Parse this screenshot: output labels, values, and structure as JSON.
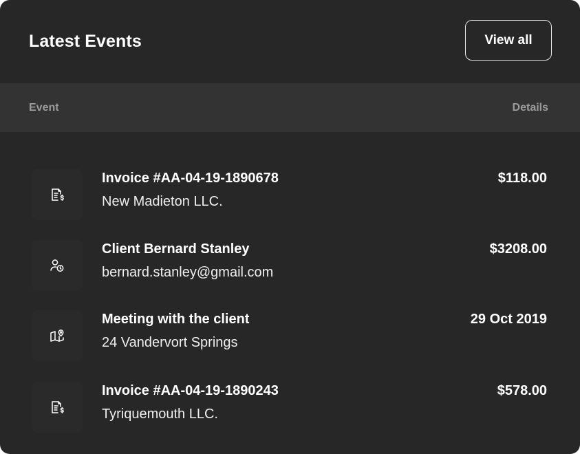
{
  "card": {
    "title": "Latest Events",
    "view_all_label": "View all"
  },
  "table": {
    "columns": {
      "event": "Event",
      "details": "Details"
    },
    "rows": [
      {
        "icon": "invoice-dollar-icon",
        "title": "Invoice #AA-04-19-1890678",
        "subtitle": "New Madieton LLC.",
        "detail": "$118.00"
      },
      {
        "icon": "user-clock-icon",
        "title": "Client Bernard Stanley",
        "subtitle": "bernard.stanley@gmail.com",
        "detail": "$3208.00"
      },
      {
        "icon": "map-pin-icon",
        "title": "Meeting with the client",
        "subtitle": "24 Vandervort Springs",
        "detail": "29 Oct 2019"
      },
      {
        "icon": "invoice-dollar-icon",
        "title": "Invoice #AA-04-19-1890243",
        "subtitle": "Tyriquemouth LLC.",
        "detail": "$578.00"
      }
    ]
  },
  "colors": {
    "card_background": "#272727",
    "header_row_background": "#333333",
    "muted_text": "#9b9b9b",
    "primary_text": "#ffffff"
  }
}
